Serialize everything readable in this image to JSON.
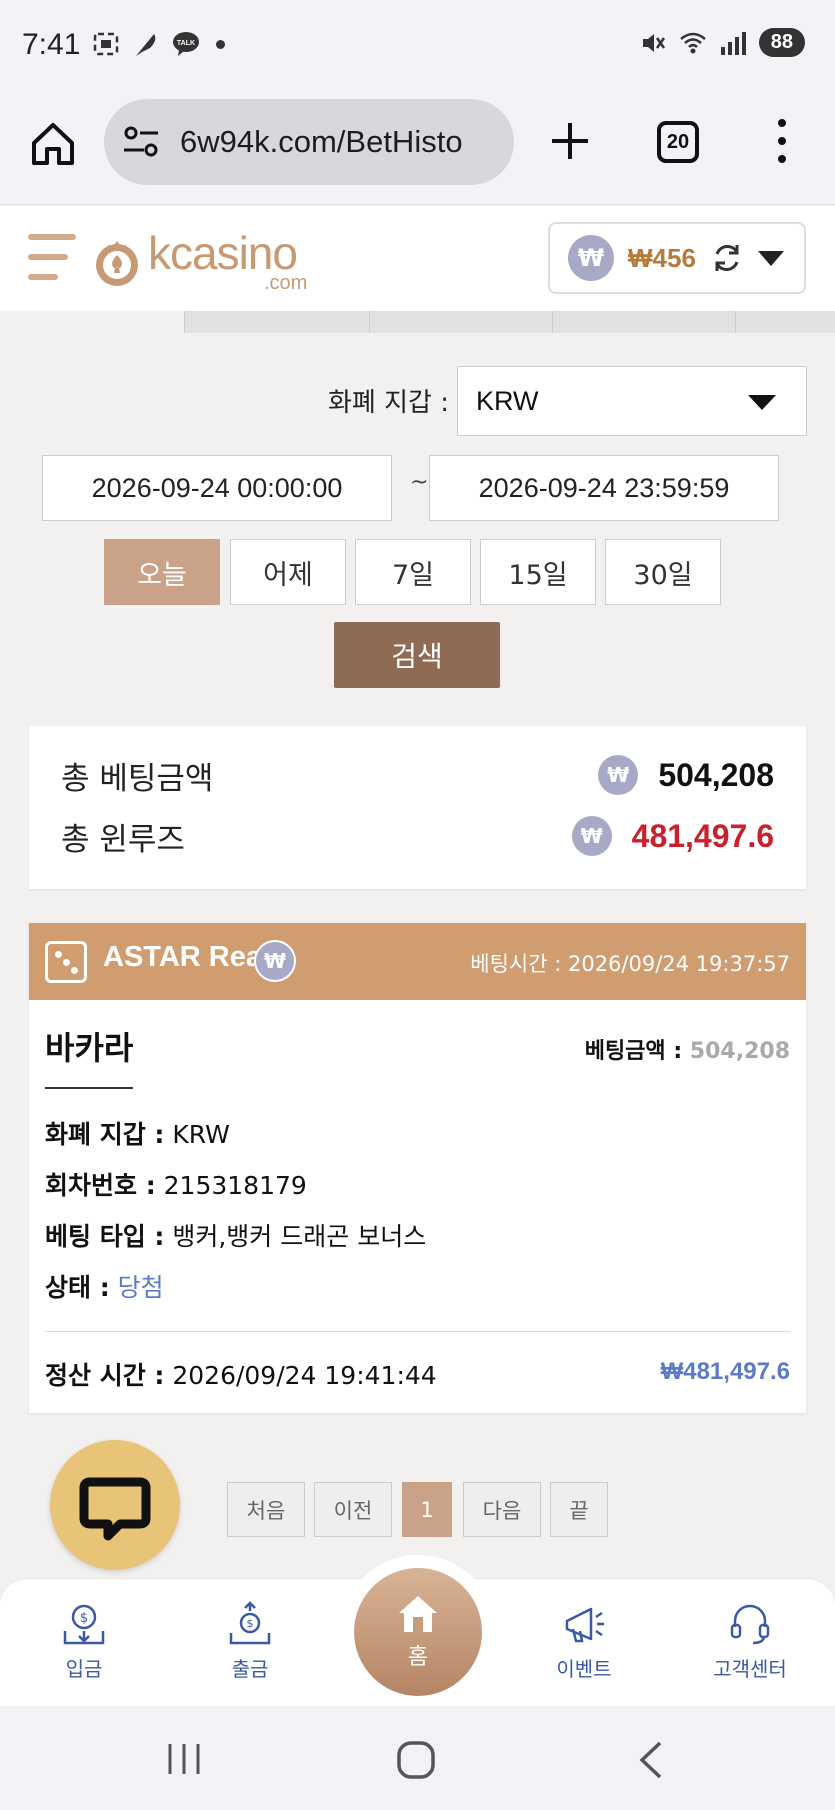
{
  "status_bar": {
    "time": "7:41",
    "battery": "88",
    "left_icons": [
      "screenshot-icon",
      "feather-icon",
      "talk-icon"
    ],
    "right_icons": [
      "mute-icon",
      "wifi-icon",
      "signal-icon"
    ]
  },
  "browser": {
    "url": "6w94k.com/BetHisto",
    "tab_count": "20"
  },
  "header": {
    "logo_text": "kcasino",
    "logo_sub": ".com",
    "balance": "₩456",
    "won_symbol": "₩"
  },
  "filters": {
    "currency_label": "화폐 지갑 :",
    "currency_value": "KRW",
    "date_from": "2026-09-24 00:00:00",
    "date_sep": "~",
    "date_to": "2026-09-24 23:59:59",
    "ranges": [
      "오늘",
      "어제",
      "7일",
      "15일",
      "30일"
    ],
    "active_range": "오늘",
    "search_label": "검색"
  },
  "totals": {
    "bet_label": "총 베팅금액",
    "bet_value": "504,208",
    "winloss_label": "총 윈루즈",
    "winloss_value": "481,497.6",
    "winloss_color": "#c8202c"
  },
  "bet": {
    "provider": "ASTAR Real",
    "bet_time_label": "베팅시간 :",
    "bet_time": "2026/09/24 19:37:57",
    "game": "바카라",
    "amount_label": "베팅금액 :",
    "amount": "504,208",
    "currency_label": "화폐 지갑 :",
    "currency": "KRW",
    "round_label": "회차번호 :",
    "round": "215318179",
    "type_label": "베팅 타입 :",
    "type": "뱅커,뱅커 드래곤 보너스",
    "status_label": "상태 :",
    "status": "당첨",
    "settle_label": "정산 시간 :",
    "settle_time": "2026/09/24 19:41:44",
    "settle_amount": "₩481,497.6"
  },
  "pagination": {
    "first": "처음",
    "prev": "이전",
    "current": "1",
    "next": "다음",
    "last": "끝"
  },
  "bottom_nav": {
    "deposit": "입금",
    "withdraw": "출금",
    "home": "홈",
    "event": "이벤트",
    "support": "고객센터"
  },
  "colors": {
    "accent": "#c9a287",
    "header_bar": "#d09d70",
    "search": "#8e6b52",
    "nav_text": "#3b5aa3"
  }
}
